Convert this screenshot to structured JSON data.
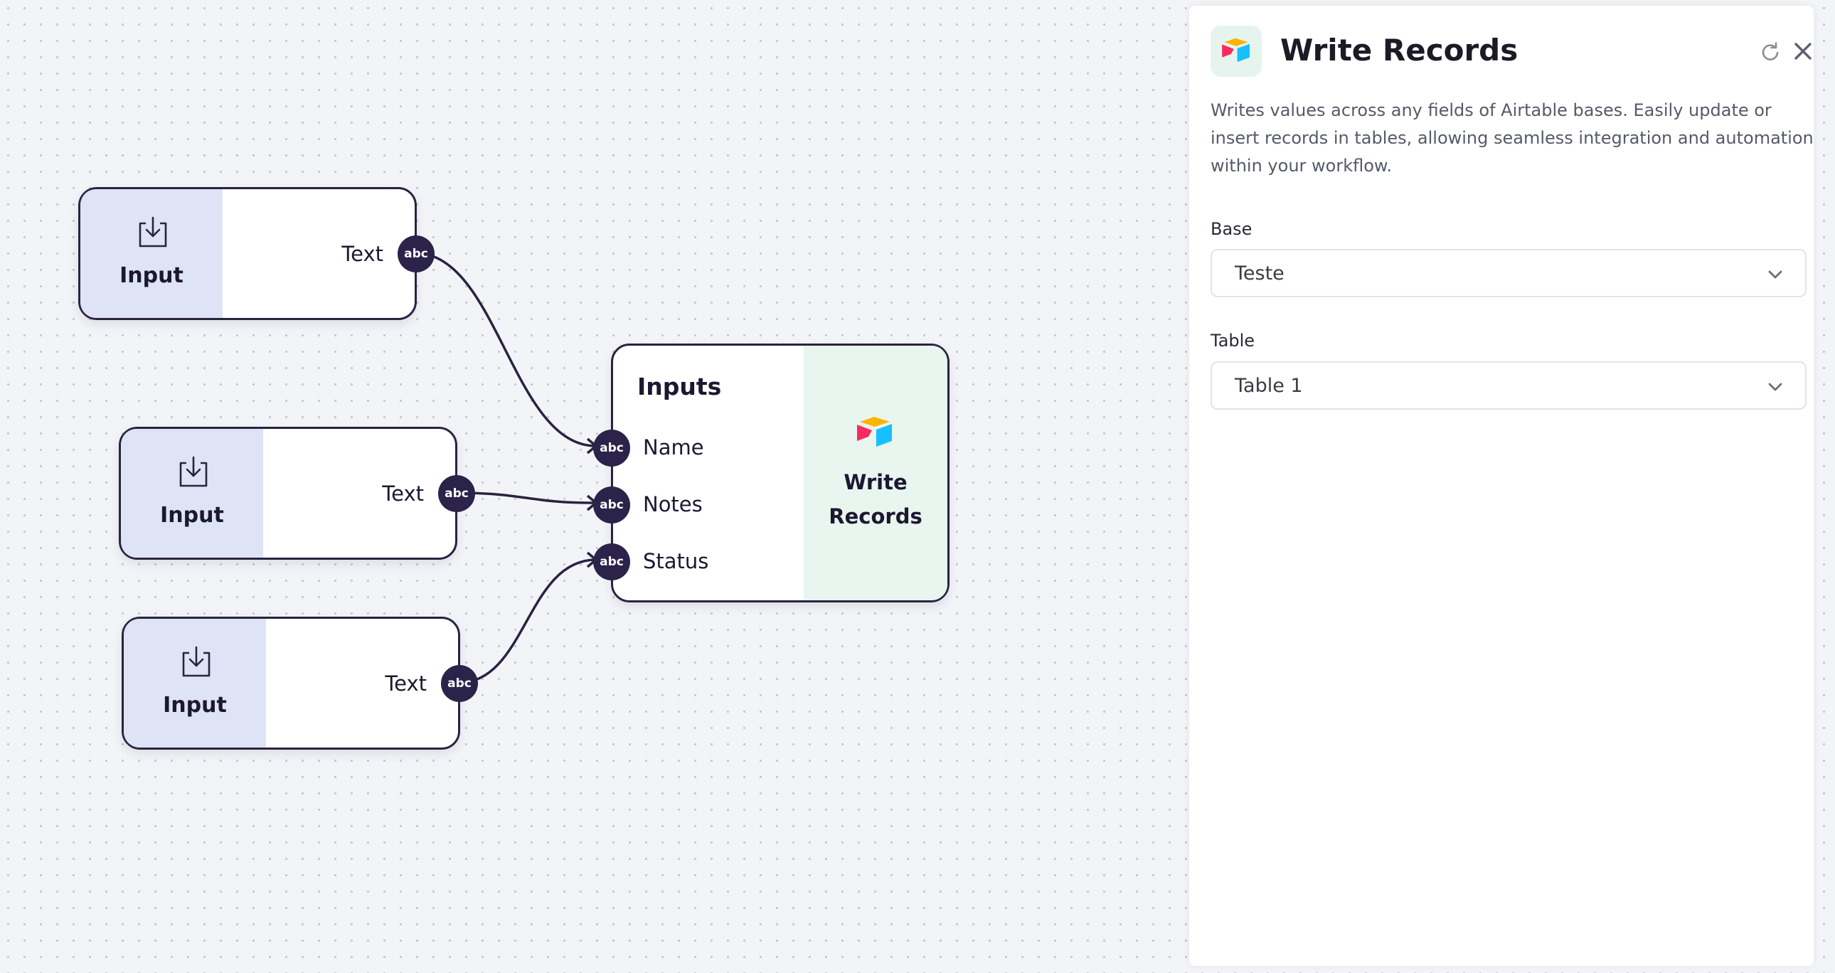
{
  "canvas": {
    "input_nodes": [
      {
        "title": "Input",
        "port_label": "Text",
        "port_type": "abc",
        "icon": "download-tray-icon"
      },
      {
        "title": "Input",
        "port_label": "Text",
        "port_type": "abc",
        "icon": "download-tray-icon"
      },
      {
        "title": "Input",
        "port_label": "Text",
        "port_type": "abc",
        "icon": "download-tray-icon"
      }
    ],
    "write_node": {
      "inputs_title": "Inputs",
      "fields": [
        {
          "label": "Name",
          "type": "abc"
        },
        {
          "label": "Notes",
          "type": "abc"
        },
        {
          "label": "Status",
          "type": "abc"
        }
      ],
      "title_line1": "Write",
      "title_line2": "Records",
      "icon": "airtable-logo-icon"
    },
    "connections": [
      {
        "from": "input-1.Text",
        "to": "Name"
      },
      {
        "from": "input-2.Text",
        "to": "Notes"
      },
      {
        "from": "input-3.Text",
        "to": "Status"
      }
    ]
  },
  "panel": {
    "title": "Write Records",
    "icon": "airtable-logo-icon",
    "description": "Writes values across any fields of Airtable bases. Easily update or insert records in tables, allowing seamless integration and automation within your workflow.",
    "base_label": "Base",
    "base_value": "Teste",
    "table_label": "Table",
    "table_value": "Table 1"
  },
  "colors": {
    "canvas_bg": "#f3f4f8",
    "node_border": "#2a2340",
    "port": "#2b2349",
    "input_node_accent": "#dfe3f6",
    "write_node_accent": "#e9f5ef",
    "airtable_yellow": "#fcb400",
    "airtable_blue": "#18bfff",
    "airtable_red": "#f82b60"
  }
}
